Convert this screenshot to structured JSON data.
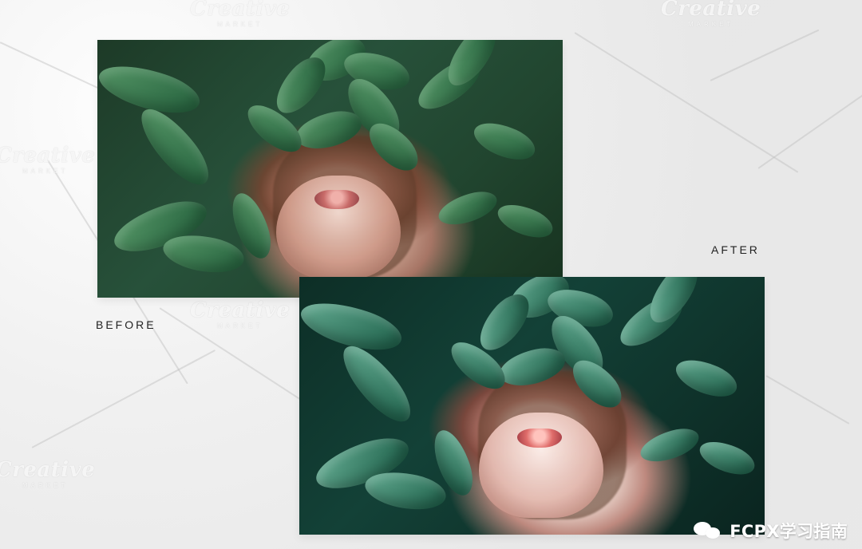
{
  "labels": {
    "before": "BEFORE",
    "after": "AFTER"
  },
  "watermarks": [
    {
      "text": "Creative",
      "subtext": "MARKET"
    }
  ],
  "logo": {
    "text": "FCPX学习指南",
    "icon": "wechat-icon"
  },
  "colors": {
    "background": "#f2f2f2",
    "label": "#222222",
    "logo_text": "#ffffff"
  }
}
